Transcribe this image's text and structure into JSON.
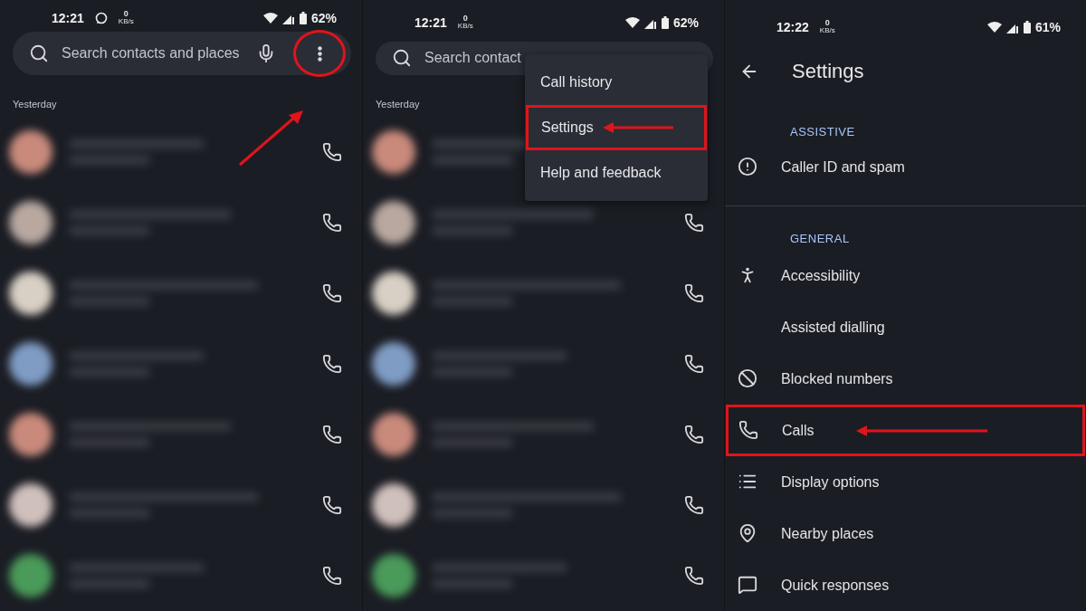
{
  "panels": [
    {
      "kind": "call_log",
      "status_bar": {
        "time": "12:21",
        "speed_value": "0",
        "speed_unit": "KB/s",
        "battery": "62%"
      },
      "search": {
        "placeholder": "Search contacts and places"
      },
      "section": "Yesterday",
      "rows": [
        {
          "color": "#c98a7c"
        },
        {
          "color": "#b8a8a0"
        },
        {
          "color": "#d8d0c4"
        },
        {
          "color": "#7f9cc4"
        },
        {
          "color": "#c98a7c"
        },
        {
          "color": "#d0c0bc"
        },
        {
          "color": "#4a9a5a"
        }
      ]
    },
    {
      "kind": "call_log_menu",
      "status_bar": {
        "time": "12:21",
        "speed_value": "0",
        "speed_unit": "KB/s",
        "battery": "62%"
      },
      "search": {
        "placeholder": "Search contact"
      },
      "section": "Yesterday",
      "rows": [
        {
          "color": "#c98a7c"
        },
        {
          "color": "#b8a8a0"
        },
        {
          "color": "#d8d0c4"
        },
        {
          "color": "#7f9cc4"
        },
        {
          "color": "#c98a7c"
        },
        {
          "color": "#d0c0bc"
        },
        {
          "color": "#4a9a5a"
        }
      ],
      "menu": [
        {
          "label": "Call history",
          "highlighted": false
        },
        {
          "label": "Settings",
          "highlighted": true
        },
        {
          "label": "Help and feedback",
          "highlighted": false
        }
      ]
    },
    {
      "kind": "settings",
      "status_bar": {
        "time": "12:22",
        "speed_value": "0",
        "speed_unit": "KB/s",
        "battery": "61%"
      },
      "title": "Settings",
      "groups": [
        {
          "header": "ASSISTIVE",
          "items": [
            {
              "label": "Caller ID and spam",
              "kind": "alert",
              "highlighted": false
            }
          ]
        },
        {
          "header": "GENERAL",
          "items": [
            {
              "label": "Accessibility",
              "kind": "person",
              "highlighted": false
            },
            {
              "label": "Assisted dialling",
              "kind": "plain",
              "highlighted": false
            },
            {
              "label": "Blocked numbers",
              "kind": "block",
              "highlighted": false
            },
            {
              "label": "Calls",
              "kind": "phone",
              "highlighted": true
            },
            {
              "label": "Display options",
              "kind": "list",
              "highlighted": false
            },
            {
              "label": "Nearby places",
              "kind": "pin",
              "highlighted": false
            },
            {
              "label": "Quick responses",
              "kind": "message",
              "highlighted": false
            }
          ]
        }
      ]
    }
  ]
}
